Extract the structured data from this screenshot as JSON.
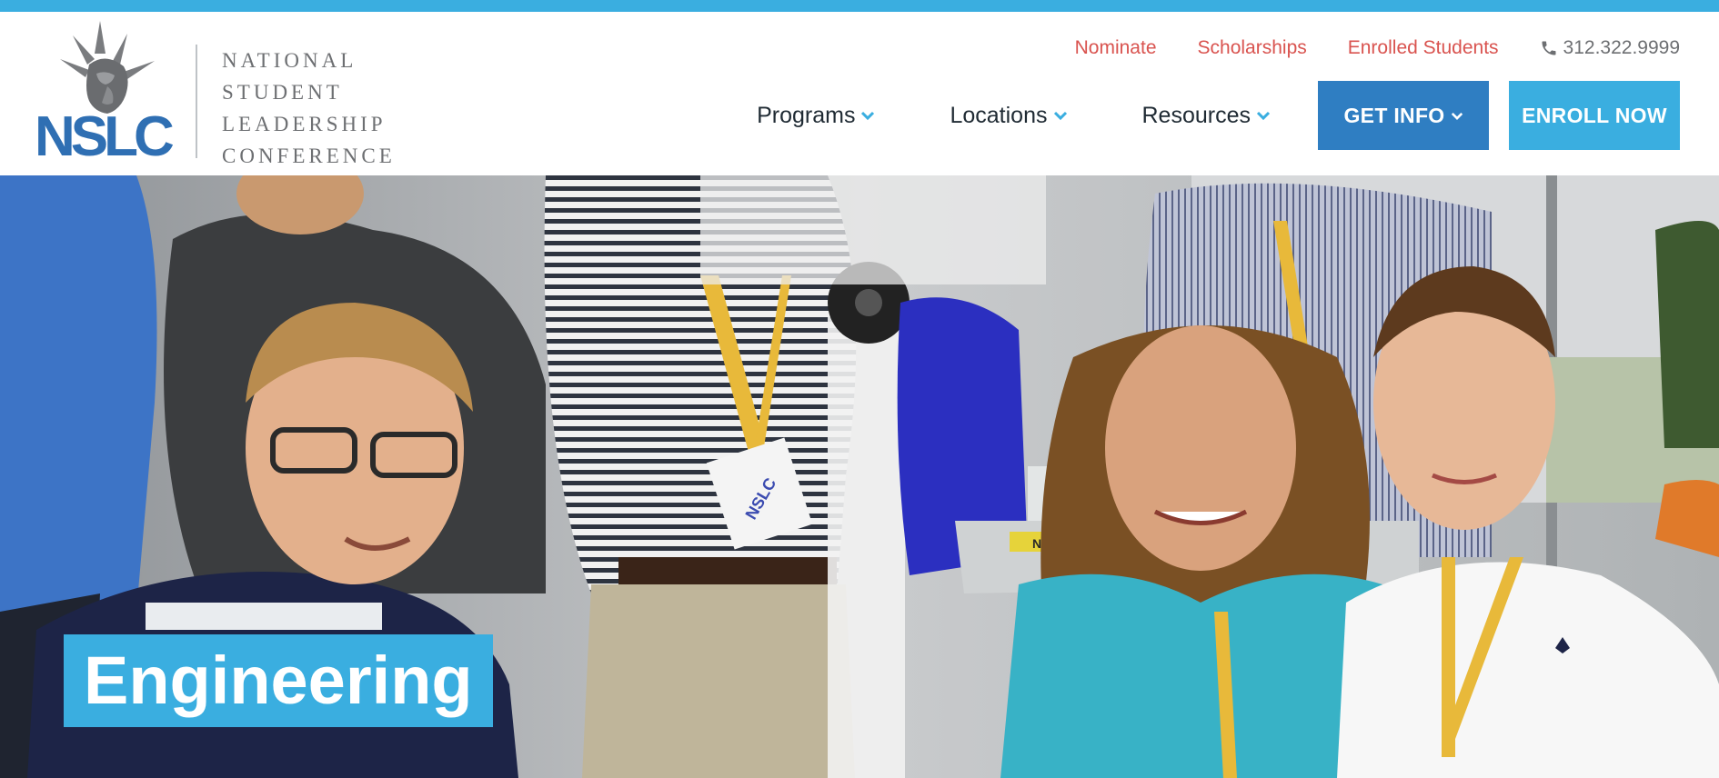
{
  "brand": {
    "logo_monogram": "NSLC",
    "wordmark_lines": [
      "NATIONAL",
      "STUDENT",
      "LEADERSHIP",
      "CONFERENCE"
    ],
    "logo_icon": "statue-of-liberty-icon"
  },
  "utility_nav": {
    "links": [
      "Nominate",
      "Scholarships",
      "Enrolled Students"
    ],
    "phone": "312.322.9999",
    "phone_icon": "phone-icon"
  },
  "main_nav": {
    "items": [
      {
        "label": "Programs",
        "icon": "chevron-down-icon"
      },
      {
        "label": "Locations",
        "icon": "chevron-down-icon"
      },
      {
        "label": "Resources",
        "icon": "chevron-down-icon"
      }
    ],
    "get_info_label": "GET INFO",
    "enroll_label": "ENROLL NOW"
  },
  "hero": {
    "title": "Engineering",
    "lanyard_card_text": "NSLC",
    "book_text": "NSLC"
  },
  "colors": {
    "accent_blue": "#3aaee0",
    "dark_blue": "#2f7ec2",
    "link_red": "#d9534f",
    "logo_blue": "#2f6fb3",
    "gray_text": "#6d6f72"
  }
}
